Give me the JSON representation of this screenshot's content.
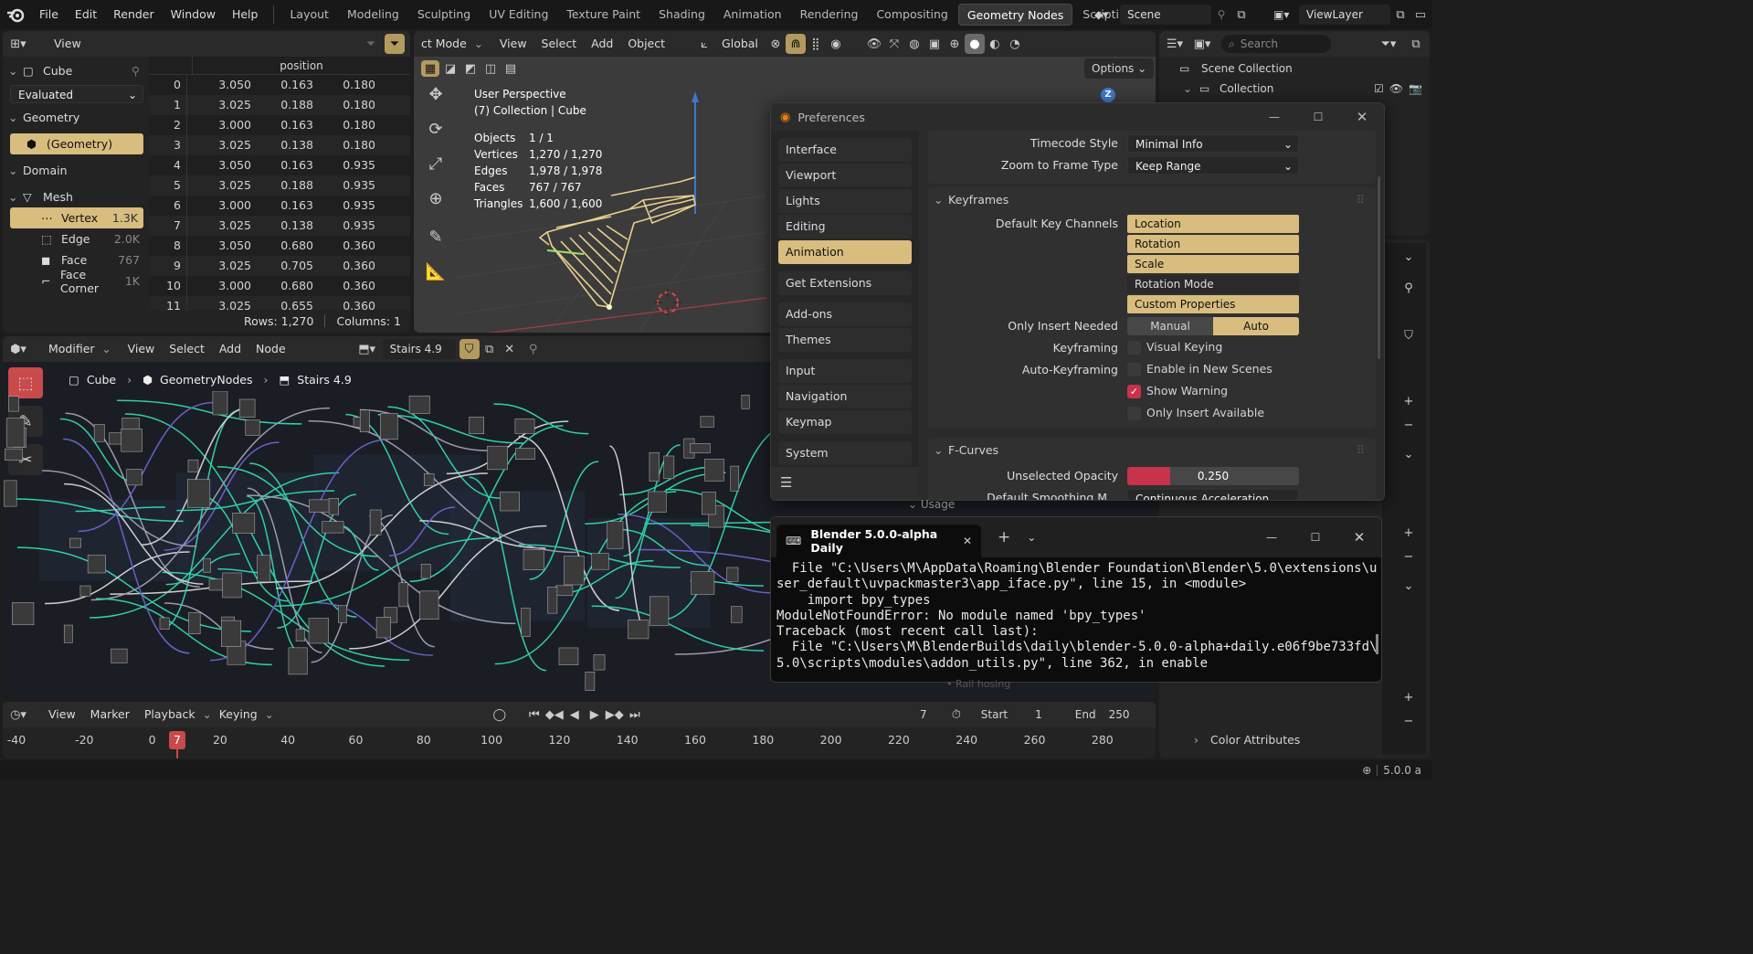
{
  "menu": [
    "File",
    "Edit",
    "Render",
    "Window",
    "Help"
  ],
  "workspaces": [
    "Layout",
    "Modeling",
    "Sculpting",
    "UV Editing",
    "Texture Paint",
    "Shading",
    "Animation",
    "Rendering",
    "Compositing",
    "Geometry Nodes",
    "Scripting"
  ],
  "active_workspace": "Geometry Nodes",
  "scene": "Scene",
  "view_layer": "ViewLayer",
  "spreadsheet": {
    "view": "View",
    "object": "Cube",
    "evaluated": "Evaluated",
    "geometry_label": "Geometry",
    "geometry_item": "(Geometry)",
    "domain_label": "Domain",
    "mesh_label": "Mesh",
    "domains": [
      {
        "name": "Vertex",
        "count": "1.3K"
      },
      {
        "name": "Edge",
        "count": "2.0K"
      },
      {
        "name": "Face",
        "count": "767"
      },
      {
        "name": "Face Corner",
        "count": "1K"
      }
    ],
    "column": "position",
    "rows": [
      [
        "0",
        "3.050",
        "0.163",
        "0.180"
      ],
      [
        "1",
        "3.025",
        "0.188",
        "0.180"
      ],
      [
        "2",
        "3.000",
        "0.163",
        "0.180"
      ],
      [
        "3",
        "3.025",
        "0.138",
        "0.180"
      ],
      [
        "4",
        "3.050",
        "0.163",
        "0.935"
      ],
      [
        "5",
        "3.025",
        "0.188",
        "0.935"
      ],
      [
        "6",
        "3.000",
        "0.163",
        "0.935"
      ],
      [
        "7",
        "3.025",
        "0.138",
        "0.935"
      ],
      [
        "8",
        "3.050",
        "0.680",
        "0.360"
      ],
      [
        "9",
        "3.025",
        "0.705",
        "0.360"
      ],
      [
        "10",
        "3.000",
        "0.680",
        "0.360"
      ],
      [
        "11",
        "3.025",
        "0.655",
        "0.360"
      ]
    ],
    "footer_rows": "Rows: 1,270",
    "footer_cols": "Columns: 1"
  },
  "viewport": {
    "mode": "ct Mode",
    "menus": [
      "View",
      "Select",
      "Add",
      "Object"
    ],
    "transform": "Global",
    "options": "Options",
    "perspective": "User Perspective",
    "collection": "(7) Collection | Cube",
    "stats": [
      {
        "label": "Objects",
        "value": "1 / 1"
      },
      {
        "label": "Vertices",
        "value": "1,270 / 1,270"
      },
      {
        "label": "Edges",
        "value": "1,978 / 1,978"
      },
      {
        "label": "Faces",
        "value": "767 / 767"
      },
      {
        "label": "Triangles",
        "value": "1,600 / 1,600"
      }
    ],
    "axis_z": "Z"
  },
  "outliner": {
    "search_placeholder": "Search",
    "scene_collection": "Scene Collection",
    "collection": "Collection"
  },
  "node_editor": {
    "editor": "Modifier",
    "menus": [
      "View",
      "Select",
      "Add",
      "Node"
    ],
    "tree_name": "Stairs 4.9",
    "breadcrumb": [
      "Cube",
      "GeometryNodes",
      "Stairs 4.9"
    ]
  },
  "preferences": {
    "title": "Preferences",
    "nav": [
      "Interface",
      "Viewport",
      "Lights",
      "Editing",
      "Animation",
      "Get Extensions",
      "Add-ons",
      "Themes",
      "Input",
      "Navigation",
      "Keymap",
      "System"
    ],
    "active": "Animation",
    "timecode_label": "Timecode Style",
    "timecode_value": "Minimal Info",
    "zoom_label": "Zoom to Frame Type",
    "zoom_value": "Keep Range",
    "keyframes_section": "Keyframes",
    "default_key_label": "Default Key Channels",
    "key_channels": [
      {
        "name": "Location",
        "on": true
      },
      {
        "name": "Rotation",
        "on": true
      },
      {
        "name": "Scale",
        "on": true
      },
      {
        "name": "Rotation Mode",
        "on": false
      },
      {
        "name": "Custom Properties",
        "on": true
      }
    ],
    "only_insert_label": "Only Insert Needed",
    "manual": "Manual",
    "auto": "Auto",
    "keyframing_label": "Keyframing",
    "visual_keying": "Visual Keying",
    "autokey_label": "Auto-Keyframing",
    "enable_new_scenes": "Enable in New Scenes",
    "show_warning": "Show Warning",
    "only_insert_available": "Only Insert Available",
    "fcurves_section": "F-Curves",
    "unselected_opacity_label": "Unselected Opacity",
    "unselected_opacity_value": "0.250",
    "unselected_opacity_fraction": 0.25,
    "smoothing_label": "Default Smoothing M...",
    "smoothing_value": "Continuous Acceleration"
  },
  "behind_terminal": {
    "usage": "Usage",
    "rail": "Rail hosing"
  },
  "terminal": {
    "tab_title": "Blender 5.0.0-alpha Daily",
    "text": "  File \"C:\\Users\\M\\AppData\\Roaming\\Blender Foundation\\Blender\\5.0\\extensions\\u\nser_default\\uvpackmaster3\\app_iface.py\", line 15, in <module>\n    import bpy_types\nModuleNotFoundError: No module named 'bpy_types'\nTraceback (most recent call last):\n  File \"C:\\Users\\M\\BlenderBuilds\\daily\\blender-5.0.0-alpha+daily.e06f9be733fd\\\n5.0\\scripts\\modules\\addon_utils.py\", line 362, in enable"
  },
  "properties": {
    "color_attributes": "Color Attributes"
  },
  "timeline": {
    "menus": [
      "View",
      "Marker",
      "Playback",
      "Keying"
    ],
    "current_frame": "7",
    "start_label": "Start",
    "start": "1",
    "end_label": "End",
    "end": "250",
    "ticks": [
      "-40",
      "-20",
      "0",
      "20",
      "40",
      "60",
      "80",
      "100",
      "120",
      "140",
      "160",
      "180",
      "200",
      "220",
      "240",
      "260",
      "280"
    ]
  },
  "status": {
    "version": "5.0.0 a"
  }
}
